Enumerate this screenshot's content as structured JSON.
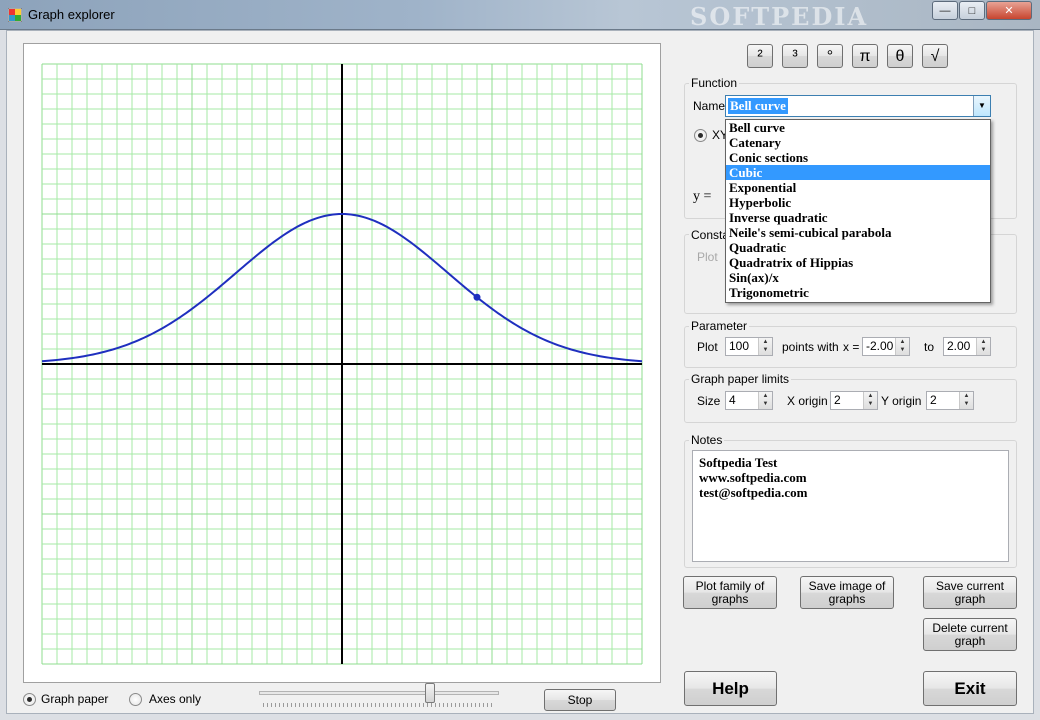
{
  "window": {
    "title": "Graph explorer",
    "watermark": "SOFTPEDIA",
    "controls": {
      "minimize": "—",
      "maximize": "□",
      "close": "✕"
    }
  },
  "graph": {
    "curve_color": "#1f2fbf",
    "grid_color": "#a6eaa6",
    "grid_major_color": "#8fdc8f",
    "axis_color": "#000000",
    "x_range": [
      -2,
      2
    ],
    "y_range": [
      -2,
      2
    ],
    "function": "bell",
    "marker_x": 0.9
  },
  "view_options": {
    "graph_paper": "Graph paper",
    "axes_only": "Axes only",
    "selected": "graph_paper"
  },
  "stop_label": "Stop",
  "symbol_buttons": [
    "²",
    "³",
    "°",
    "π",
    "θ",
    "√"
  ],
  "function_group": {
    "title": "Function",
    "name_label": "Name",
    "selected": "Bell curve",
    "radio_label": "XY",
    "y_label": "y =",
    "options": [
      "Bell curve",
      "Catenary",
      "Conic sections",
      "Cubic",
      "Exponential",
      "Hyperbolic",
      "Inverse quadratic",
      "Neile's semi-cubical parabola",
      "Quadratic",
      "Quadratrix of Hippias",
      "Sin(ax)/x",
      "Trigonometric"
    ],
    "highlighted": "Cubic"
  },
  "constants_group": {
    "title": "Constar",
    "plot_label": "Plot"
  },
  "parameter_group": {
    "title": "Parameter",
    "plot_label": "Plot",
    "plot_value": "100",
    "points_label": "points with",
    "x_label": "x =",
    "from_value": "-2.00",
    "to_label": "to",
    "to_value": "2.00"
  },
  "limits_group": {
    "title": "Graph paper limits",
    "size_label": "Size",
    "size_value": "4",
    "xorigin_label": "X origin",
    "xorigin_value": "2",
    "yorigin_label": "Y origin",
    "yorigin_value": "2"
  },
  "notes_group": {
    "title": "Notes",
    "lines": [
      "Softpedia Test",
      "www.softpedia.com",
      "test@softpedia.com"
    ]
  },
  "buttons": {
    "plot_family": [
      "Plot family of",
      "graphs"
    ],
    "save_image": [
      "Save image of",
      "graphs"
    ],
    "save_current": [
      "Save current",
      "graph"
    ],
    "delete_current": [
      "Delete current",
      "graph"
    ],
    "help": "Help",
    "exit": "Exit"
  }
}
